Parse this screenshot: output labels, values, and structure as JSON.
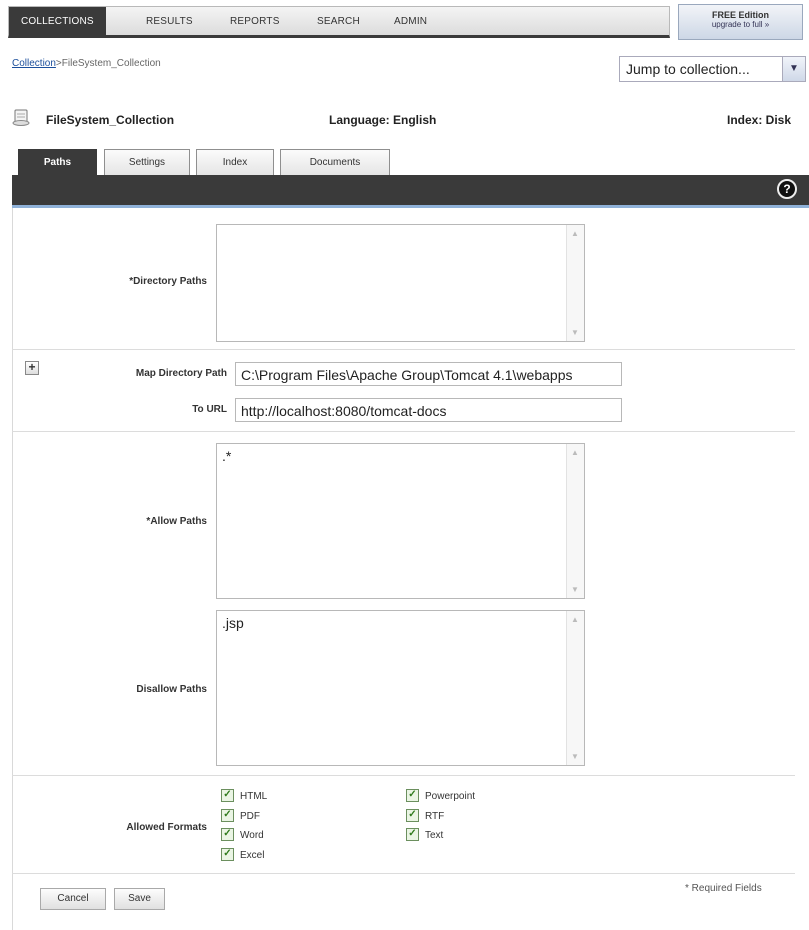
{
  "nav": {
    "tabs": [
      "COLLECTIONS",
      "RESULTS",
      "REPORTS",
      "SEARCH",
      "ADMIN"
    ],
    "active": "COLLECTIONS",
    "edition_title": "FREE Edition",
    "edition_link": "upgrade to full »"
  },
  "breadcrumb": {
    "link": "Collection",
    "current": "FileSystem_Collection",
    "separator": ">"
  },
  "jump": {
    "label": "Jump to collection...",
    "icon": "chevron-down-icon"
  },
  "collection": {
    "name": "FileSystem_Collection",
    "language": "Language: English",
    "index": "Index: Disk"
  },
  "tabs": [
    "Paths",
    "Settings",
    "Index",
    "Documents"
  ],
  "form": {
    "directory_paths_label": "*Directory Paths",
    "directory_paths_value": "",
    "map_label": "Map Directory Path",
    "map_value": "C:\\Program Files\\Apache Group\\Tomcat 4.1\\webapps",
    "url_label": "To URL",
    "url_value": "http://localhost:8080/tomcat-docs",
    "allow_label": "*Allow Paths",
    "allow_value": ".*",
    "disallow_label": "Disallow Paths",
    "disallow_value": ".jsp",
    "formats_label": "Allowed Formats",
    "formats_col1": [
      "HTML",
      "PDF",
      "Word",
      "Excel"
    ],
    "formats_col2": [
      "Powerpoint",
      "RTF",
      "Text"
    ]
  },
  "buttons": {
    "cancel": "Cancel",
    "save": "Save"
  },
  "required_note": "* Required Fields",
  "colors": {
    "nav_dark": "#3a3a3a",
    "accent_blue": "#8fb1d8",
    "link": "#1c4f9c"
  }
}
